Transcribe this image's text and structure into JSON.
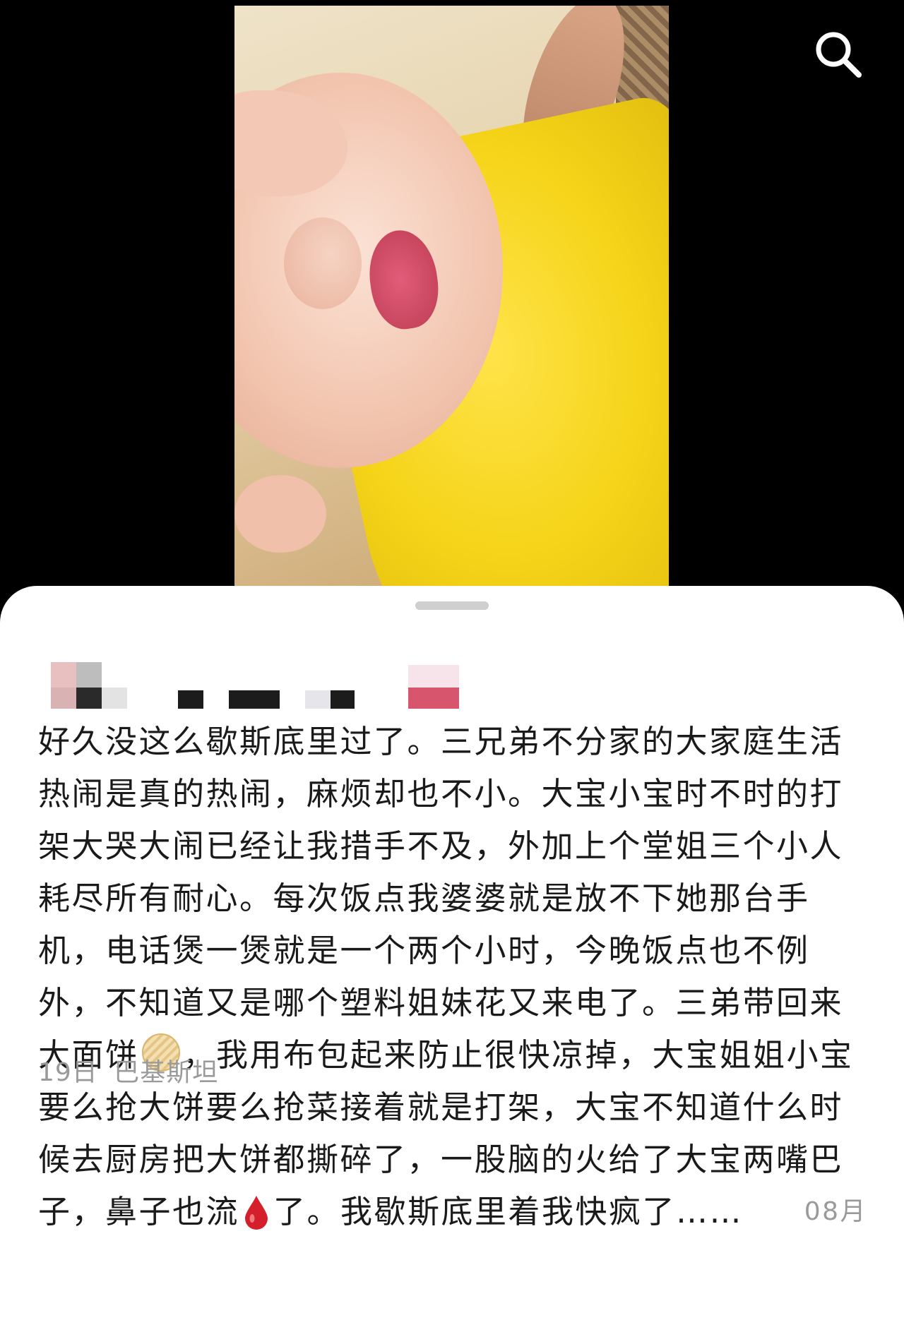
{
  "header": {
    "search_icon": "search-icon"
  },
  "post": {
    "lines": [
      "好久没这么歇斯底里过了。三兄弟不分家的大家庭生活",
      "热闹是真的热闹，麻烦却也不小。大宝小宝时不时的打",
      "架大哭大闹已经让我措手不及，外加上个堂姐三个小人",
      "耗尽所有耐心。每次饭点我婆婆就是放不下她那台手",
      "机，电话煲一煲就是一个两个小时，今晚饭点也不例",
      "外，不知道又是哪个塑料姐妹花又来电了。三弟带回来"
    ],
    "line7_a": "大面饼",
    "line7_b": "，我用布包起来防止很快凉掉，大宝姐姐小宝",
    "line8": "要么抢大饼要么抢菜接着就是打架，大宝不知道什么时",
    "line9": "候去厨房把大饼都撕碎了，一股脑的火给了大宝两嘴巴",
    "line10_a": "子，鼻子也流",
    "line10_b": "了。我歇斯底里着我快疯了……",
    "date_part1": "08月",
    "date_part2": "19日",
    "location": "巴基斯坦",
    "emoji_pancake": "pancake-emoji",
    "emoji_blood": "blood-drop-emoji"
  },
  "colors": {
    "background": "#000000",
    "sheet": "#ffffff",
    "text": "#1a1a1a",
    "meta": "#9a9a9a"
  }
}
